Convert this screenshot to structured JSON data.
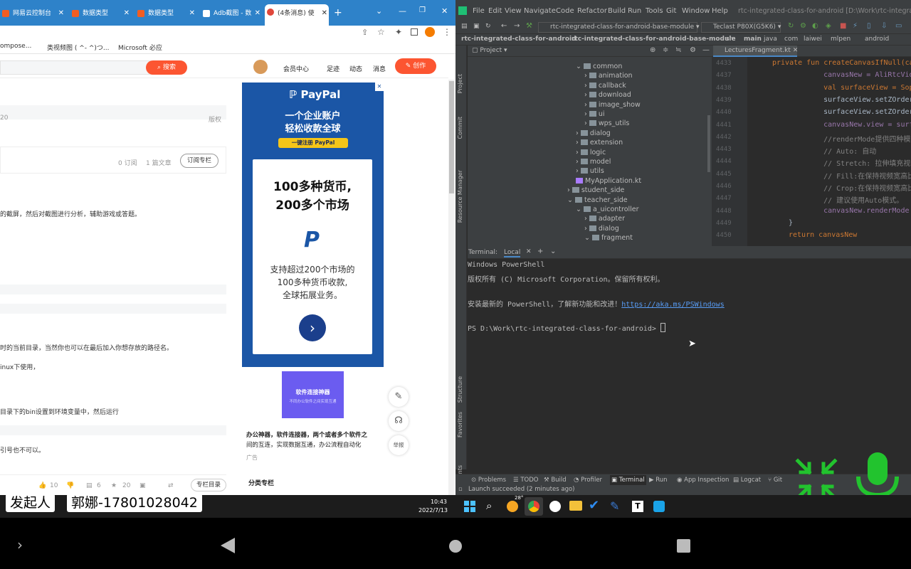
{
  "browser": {
    "tabs": [
      {
        "label": "网易云控制台"
      },
      {
        "label": "数据类型"
      },
      {
        "label": "数据类型"
      },
      {
        "label": "Adb截图 - 数"
      },
      {
        "label": "(4条消息) 使"
      }
    ],
    "new_tab": "+",
    "bookmarks": [
      "ompose...",
      "类视频图 ( ^- ^)つ...",
      "Microsoft 必应"
    ],
    "header": {
      "search_button": "搜索",
      "nav": [
        "会员中心",
        "足迹",
        "动态",
        "消息"
      ],
      "create_button": "创作"
    },
    "article": {
      "meta_date": "20",
      "copyright": "版权",
      "subscribe_count": "0 订阅",
      "article_count": "1 篇文章",
      "subscribe_button": "订阅专栏",
      "line1": "的截屏，然后对截图进行分析，辅助游戏或答题。",
      "line2": "时的当前目录，当然你也可以在最后加入你想存放的路径名。",
      "line3": "inux下使用，",
      "line4": "目录下的bin设置到环境变量中，然后运行",
      "line5": "引号也不可以。",
      "likes": "10",
      "comments": "6",
      "stars": "20",
      "column_toc": "专栏目录"
    },
    "ad": {
      "brand": "PayPal",
      "headline1": "一个企业账户",
      "headline2": "轻松收款全球",
      "cta": "一键注册 PayPal",
      "card_title1": "100多种货币,",
      "card_title2": "200多个市场",
      "card_body1": "支持超过200个市场的",
      "card_body2": "100多种货币收款,",
      "card_body3": "全球拓展业务。",
      "promo_title": "软件连接神器",
      "promo_sub": "不同办公软件之间实现互通",
      "promo_text1": "办公神器，软件连接器，两个或者多个软件之",
      "promo_text2": "间的互连，实现数据互通，办公流程自动化",
      "promo_tag": "广告",
      "category": "分类专栏",
      "report": "举报"
    }
  },
  "ide": {
    "menu": [
      "File",
      "Edit",
      "View",
      "Navigate",
      "Code",
      "Refactor",
      "Build",
      "Run",
      "Tools",
      "Git",
      "Window",
      "Help"
    ],
    "window_title": "rtc-integrated-class-for-android [D:\\Work\\rtc-integrated-c",
    "run_config": "rtc-integrated-class-for-android-base-module",
    "device": "Teclast P80X(G5K6)",
    "breadcrumb": [
      "rtc-integrated-class-for-android",
      "rtc-integrated-class-for-android-base-module",
      "src",
      "main",
      "java",
      "com",
      "laiwei",
      "mlpen",
      "android",
      "LecturesFragment.kt"
    ],
    "project_label": "Project",
    "file_tab": "LecturesFragment.kt",
    "tree": [
      {
        "label": "common",
        "indent": 1
      },
      {
        "label": "animation",
        "indent": 2
      },
      {
        "label": "callback",
        "indent": 2
      },
      {
        "label": "download",
        "indent": 2
      },
      {
        "label": "image_show",
        "indent": 2
      },
      {
        "label": "ui",
        "indent": 2
      },
      {
        "label": "wps_utils",
        "indent": 2
      },
      {
        "label": "dialog",
        "indent": 1
      },
      {
        "label": "extension",
        "indent": 1
      },
      {
        "label": "logic",
        "indent": 1
      },
      {
        "label": "model",
        "indent": 1
      },
      {
        "label": "utils",
        "indent": 1
      },
      {
        "label": "MyApplication.kt",
        "indent": 1
      },
      {
        "label": "student_side",
        "indent": 0
      },
      {
        "label": "teacher_side",
        "indent": 0
      },
      {
        "label": "a_uicontroller",
        "indent": 1
      },
      {
        "label": "adapter",
        "indent": 2
      },
      {
        "label": "dialog",
        "indent": 2
      },
      {
        "label": "fragment",
        "indent": 2
      }
    ],
    "line_numbers": [
      "4433",
      "4437",
      "4438",
      "4439",
      "4440",
      "4441",
      "4442",
      "4443",
      "4444",
      "4445",
      "4446",
      "4447",
      "4448",
      "4449",
      "4450"
    ],
    "code_lines": [
      "private fun createCanvasIfNull(ca",
      "    canvasNew = AliRtcVideoCa",
      "    val surfaceView = SophonS",
      "    surfaceView.setZOrderOnTo",
      "    surfaceView.setZOrderMedi",
      "    canvasNew.view = surfaceV",
      "    //renderMode提供四种模式:",
      "    // Auto: 自动",
      "    // Stretch: 拉伸填充视图,不",
      "    // Fill:在保持视频宽高比的同",
      "    // Crop:在保持视频宽高比的同",
      "    // 建议使用Auto模式。",
      "    canvasNew.renderMode = AT",
      "}",
      "return canvasNew"
    ],
    "terminal": {
      "label": "Terminal:",
      "tab": "Local",
      "line1": "Windows PowerShell",
      "line2": "版权所有 (C) Microsoft Corporation。保留所有权利。",
      "line3": "安装最新的 PowerShell，了解新功能和改进！",
      "link": "https://aka.ms/PSWindows",
      "prompt": "PS D:\\Work\\rtc-integrated-class-for-android> "
    },
    "side_tabs": [
      "Project",
      "Commit",
      "Resource Manager",
      "Structure",
      "Favorites",
      "Build Variants"
    ],
    "bottom_tabs": [
      "Problems",
      "TODO",
      "Build",
      "Profiler",
      "Terminal",
      "Run",
      "App Inspection",
      "Logcat",
      "Git"
    ],
    "status": "Launch succeeded (2 minutes ago)"
  },
  "taskbar": {
    "time": "10:43",
    "date": "2022/7/13",
    "weather": "28°"
  },
  "overlay": {
    "initiator_label": "发起人",
    "initiator_name": "郭娜-17801028042"
  },
  "colors": {
    "csdn_red": "#fc5531",
    "chrome_blue": "#2e82c9",
    "ide_bg": "#2b2b2b",
    "green_icon": "#22c32e"
  }
}
